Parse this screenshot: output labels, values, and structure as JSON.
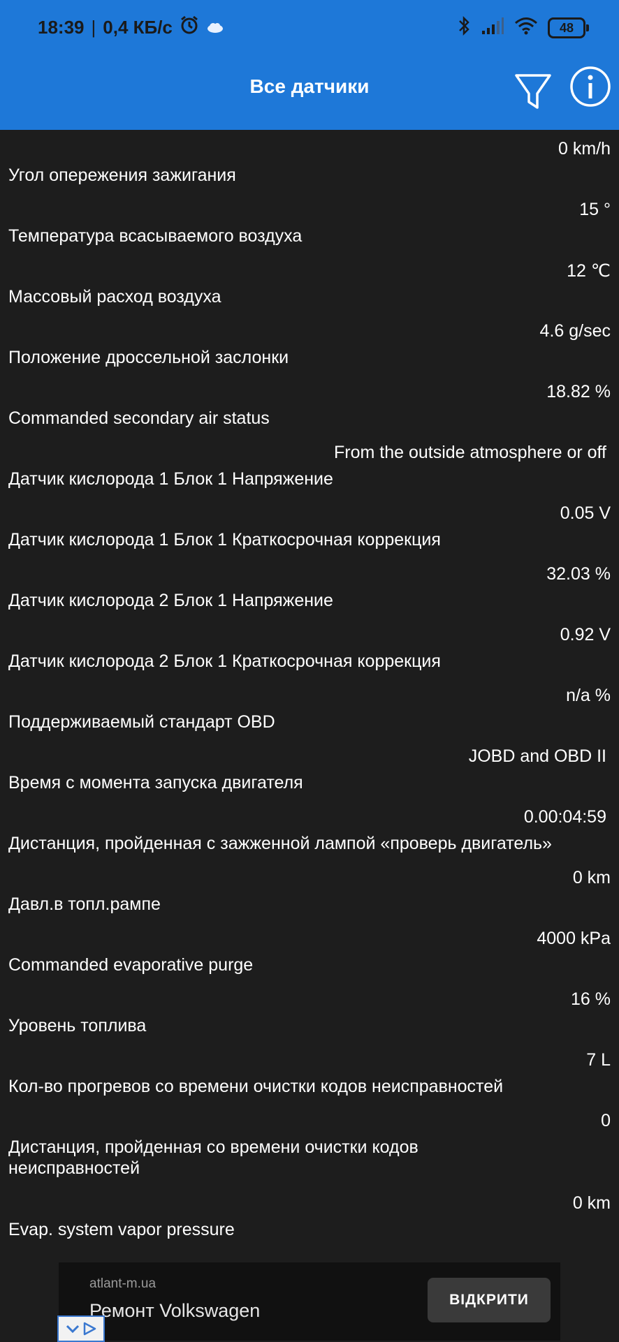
{
  "status": {
    "time": "18:39",
    "separator": "|",
    "speed": "0,4 КБ/с",
    "battery": "48"
  },
  "appbar": {
    "title": "Все датчики"
  },
  "sensors": [
    {
      "name": "",
      "value": "0 km/h"
    },
    {
      "name": "Угол опережения зажигания",
      "value": "15 °"
    },
    {
      "name": "Температура всасываемого воздуха",
      "value": "12 ℃"
    },
    {
      "name": "Массовый расход воздуха",
      "value": "4.6 g/sec"
    },
    {
      "name": "Положение дроссельной заслонки",
      "value": "18.82 %"
    },
    {
      "name": "Commanded secondary air status",
      "value": "From the outside atmosphere or off"
    },
    {
      "name": "Датчик кислорода 1 Блок 1 Напряжение",
      "value": "0.05 V"
    },
    {
      "name": "Датчик кислорода 1 Блок 1 Краткосрочная коррекция",
      "value": "32.03 %"
    },
    {
      "name": "Датчик кислорода 2 Блок 1 Напряжение",
      "value": "0.92 V"
    },
    {
      "name": "Датчик кислорода 2 Блок 1 Краткосрочная коррекция",
      "value": "n/a %"
    },
    {
      "name": "Поддерживаемый стандарт OBD",
      "value": "JOBD and OBD II"
    },
    {
      "name": "Время с момента запуска двигателя",
      "value": "0.00:04:59"
    },
    {
      "name": "Дистанция, пройденная с зажженной лампой «проверь двигатель»",
      "value": "0 km"
    },
    {
      "name": "Давл.в топл.рампе",
      "value": "4000 kPa"
    },
    {
      "name": "Commanded evaporative purge",
      "value": "16 %"
    },
    {
      "name": "Уровень топлива",
      "value": "7 L"
    },
    {
      "name": "Кол-во прогревов со времени очистки кодов неисправностей",
      "value": "0"
    },
    {
      "name": "Дистанция, пройденная со времени очистки кодов неисправностей",
      "value": "0 km"
    },
    {
      "name": "Evap. system vapor pressure",
      "value": ""
    }
  ],
  "ad": {
    "domain": "atlant-m.ua",
    "title": "Ремонт Volkswagen",
    "button": "ВІДКРИТИ"
  },
  "colors": {
    "accent": "#1e78d8",
    "background": "#1d1d1d",
    "text": "#ffffff"
  }
}
